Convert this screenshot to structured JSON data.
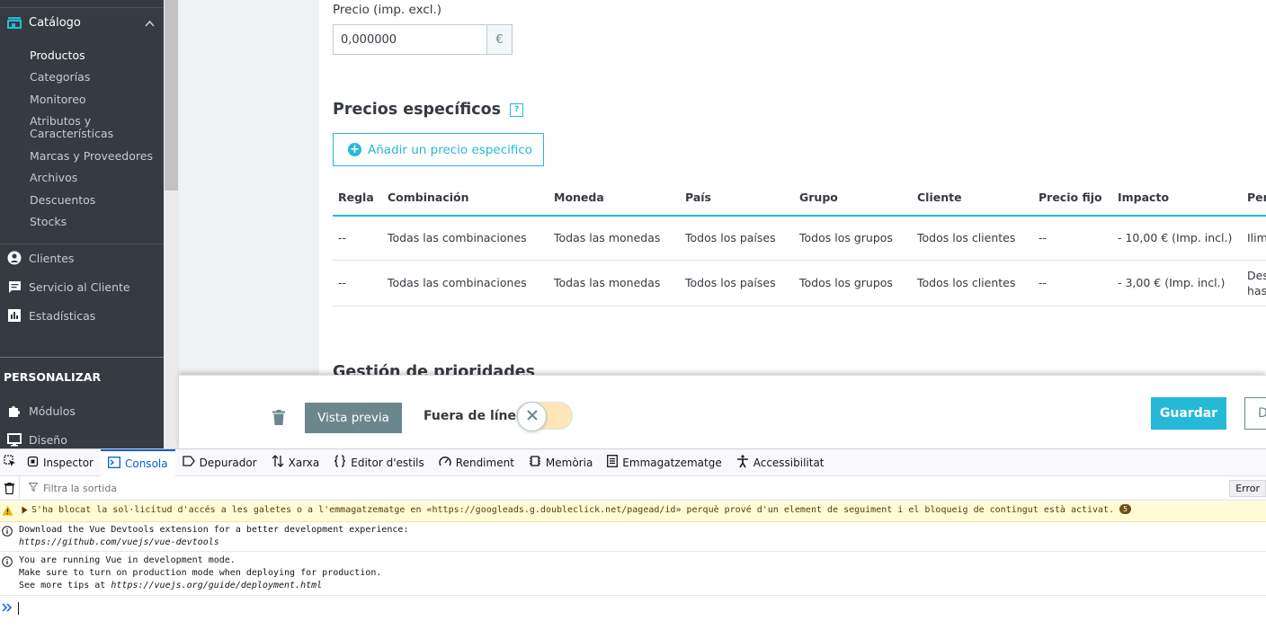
{
  "sidebar": {
    "catalog_label": "Catálogo",
    "sub_items": [
      {
        "label": "Productos"
      },
      {
        "label": "Categorías"
      },
      {
        "label": "Monitoreo"
      },
      {
        "label": "Atributos y"
      },
      {
        "label": "Características"
      },
      {
        "label": "Marcas y Proveedores"
      },
      {
        "label": "Archivos"
      },
      {
        "label": "Descuentos"
      },
      {
        "label": "Stocks"
      }
    ],
    "main_items": [
      {
        "label": "Clientes",
        "icon": "user-icon"
      },
      {
        "label": "Servicio al Cliente",
        "icon": "chat-icon"
      },
      {
        "label": "Estadísticas",
        "icon": "chart-icon"
      }
    ],
    "section_title": "PERSONALIZAR",
    "custom_items": [
      {
        "label": "Módulos",
        "icon": "puzzle-icon"
      },
      {
        "label": "Diseño",
        "icon": "monitor-icon"
      }
    ]
  },
  "content": {
    "price_label": "Precio (imp. excl.)",
    "price_value": "0,000000",
    "currency_symbol": "€",
    "specific_prices_title": "Precios específicos",
    "help_glyph": "?",
    "add_button_label": "Añadir un precio especifico",
    "table": {
      "headers": [
        "Regla",
        "Combinación",
        "Moneda",
        "País",
        "Grupo",
        "Cliente",
        "Precio fijo",
        "Impacto",
        "Per"
      ],
      "rows": [
        [
          "--",
          "Todas las combinaciones",
          "Todas las monedas",
          "Todos los países",
          "Todos los grupos",
          "Todos los clientes",
          "--",
          "- 10,00 € (Imp. incl.)",
          "Ilim"
        ],
        [
          "--",
          "Todas las combinaciones",
          "Todas las monedas",
          "Todos los países",
          "Todos los grupos",
          "Todos los clientes",
          "--",
          "- 3,00 € (Imp. incl.)",
          "Des has"
        ]
      ]
    },
    "next_section_title": "Gestión de prioridades"
  },
  "footer": {
    "preview_label": "Vista previa",
    "offline_label": "Fuera de línea",
    "save_label": "Guardar",
    "duplicate_label": "D"
  },
  "devtools": {
    "tabs": [
      {
        "label": "Inspector",
        "icon": "inspector-icon"
      },
      {
        "label": "Consola",
        "icon": "console-icon",
        "active": true
      },
      {
        "label": "Depurador",
        "icon": "debugger-icon"
      },
      {
        "label": "Xarxa",
        "icon": "network-icon"
      },
      {
        "label": "Editor d'estils",
        "icon": "style-editor-icon"
      },
      {
        "label": "Rendiment",
        "icon": "performance-icon"
      },
      {
        "label": "Memòria",
        "icon": "memory-icon"
      },
      {
        "label": "Emmagatzematge",
        "icon": "storage-icon"
      },
      {
        "label": "Accessibilitat",
        "icon": "accessibility-icon"
      }
    ],
    "filter_placeholder": "Filtra la sortida",
    "errors_label": "Error",
    "warning_text": "S'ha blocat la sol·licitud d'accés a les galetes o a l'emmagatzematge en «https://googleads.g.doubleclick.net/pagead/id» perquè prové d'un element de seguiment i el bloqueig de contingut està activat.",
    "warning_count": "5",
    "msg1_line1": "Download the Vue Devtools extension for a better development experience:",
    "msg1_line2": "https://github.com/vuejs/vue-devtools",
    "msg2_line1": "You are running Vue in development mode.",
    "msg2_line2": "Make sure to turn on production mode when deploying for production.",
    "msg2_line3_prefix": "See more tips at ",
    "msg2_line3_link": "https://vuejs.org/guide/deployment.html"
  },
  "colors": {
    "accent": "#25b9d7",
    "sidebar_bg": "#363a41",
    "devtools_accent": "#0060df",
    "warning_bg": "#fffbd6"
  }
}
